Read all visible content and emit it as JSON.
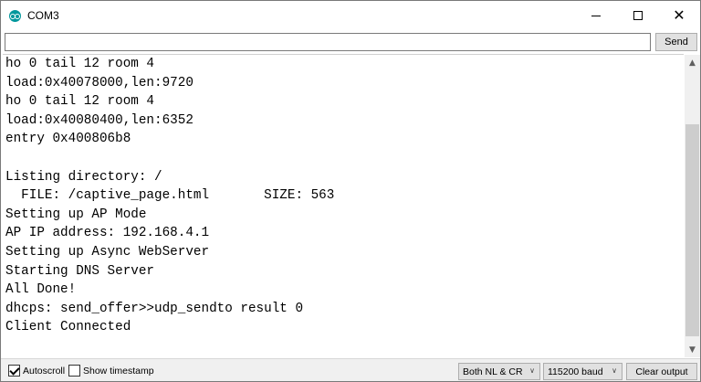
{
  "window": {
    "title": "COM3"
  },
  "titlebar": {
    "minimize_icon": "minimize-icon",
    "maximize_icon": "maximize-icon",
    "close_icon": "close-icon",
    "close_glyph": "✕"
  },
  "input": {
    "value": "",
    "send_label": "Send"
  },
  "output": {
    "lines": [
      "ho 0 tail 12 room 4",
      "load:0x40078000,len:9720",
      "ho 0 tail 12 room 4",
      "load:0x40080400,len:6352",
      "entry 0x400806b8",
      "",
      "Listing directory: /",
      "  FILE: /captive_page.html       SIZE: 563",
      "Setting up AP Mode",
      "AP IP address: 192.168.4.1",
      "Setting up Async WebServer",
      "Starting DNS Server",
      "All Done!",
      "dhcps: send_offer>>udp_sendto result 0",
      "Client Connected",
      ""
    ]
  },
  "bottombar": {
    "autoscroll_label": "Autoscroll",
    "autoscroll_checked": true,
    "timestamp_label": "Show timestamp",
    "timestamp_checked": false,
    "line_ending": "Both NL & CR",
    "baud_rate": "115200 baud",
    "clear_label": "Clear output"
  },
  "colors": {
    "accent": "#00979c",
    "button_bg": "#e1e1e1",
    "bar_bg": "#f0f0f0"
  }
}
